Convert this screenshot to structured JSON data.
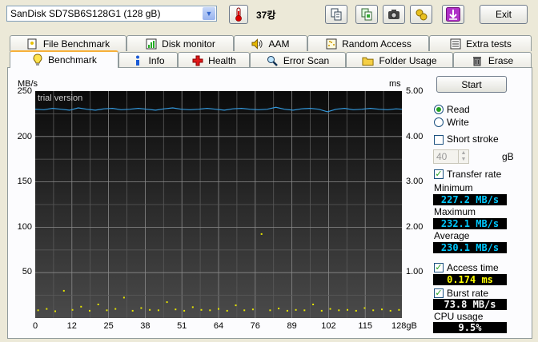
{
  "header": {
    "drive": "SanDisk SD7SB6S128G1 (128 gB)",
    "temperature": "37캉",
    "exit_label": "Exit"
  },
  "tabs_top": [
    {
      "label": "File Benchmark",
      "icon": "file-benchmark-icon"
    },
    {
      "label": "Disk monitor",
      "icon": "disk-monitor-icon"
    },
    {
      "label": "AAM",
      "icon": "speaker-icon"
    },
    {
      "label": "Random Access",
      "icon": "random-access-icon"
    },
    {
      "label": "Extra tests",
      "icon": "extra-tests-icon"
    }
  ],
  "tabs_bottom": [
    {
      "label": "Benchmark",
      "icon": "benchmark-icon",
      "active": true
    },
    {
      "label": "Info",
      "icon": "info-icon"
    },
    {
      "label": "Health",
      "icon": "health-icon"
    },
    {
      "label": "Error Scan",
      "icon": "magnifier-icon"
    },
    {
      "label": "Folder Usage",
      "icon": "folder-icon"
    },
    {
      "label": "Erase",
      "icon": "trash-icon"
    }
  ],
  "controls": {
    "start_label": "Start",
    "read_label": "Read",
    "write_label": "Write",
    "mode_selected": "Read",
    "short_stroke_label": "Short stroke",
    "short_stroke_checked": false,
    "short_stroke_value": "40",
    "short_stroke_unit": "gB",
    "transfer_rate_label": "Transfer rate",
    "transfer_rate_checked": true,
    "minimum_label": "Minimum",
    "minimum_value": "227.2 MB/s",
    "maximum_label": "Maximum",
    "maximum_value": "232.1 MB/s",
    "average_label": "Average",
    "average_value": "230.1 MB/s",
    "access_time_label": "Access time",
    "access_time_checked": true,
    "access_time_value": "0.174 ms",
    "burst_rate_label": "Burst rate",
    "burst_rate_checked": true,
    "burst_rate_value": "73.8 MB/s",
    "cpu_usage_label": "CPU usage",
    "cpu_usage_value": "9.5%"
  },
  "colors": {
    "transfer_line": "#3399dd",
    "access_points": "#e6e600",
    "value_cyan": "#00c8ff",
    "value_yellow": "#ffff00",
    "value_white": "#ffffff"
  },
  "chart_data": {
    "type": "line",
    "watermark": "trial version",
    "y_left_unit": "MB/s",
    "y_right_unit": "ms",
    "y_left_ticks": [
      "250",
      "200",
      "150",
      "100",
      "50"
    ],
    "y_right_ticks": [
      "5.00",
      "4.00",
      "3.00",
      "2.00",
      "1.00"
    ],
    "x_ticks": [
      "0",
      "12",
      "25",
      "38",
      "51",
      "64",
      "76",
      "89",
      "102",
      "115",
      "128gB"
    ],
    "xlim": [
      0,
      128
    ],
    "ylim_left": [
      0,
      250
    ],
    "ylim_right": [
      0,
      5
    ],
    "grid": true,
    "series": [
      {
        "name": "Transfer rate",
        "axis": "left",
        "x": [
          0,
          3,
          6,
          9,
          12,
          15,
          18,
          21,
          24,
          27,
          30,
          33,
          36,
          39,
          42,
          45,
          48,
          51,
          54,
          57,
          60,
          63,
          66,
          69,
          72,
          75,
          78,
          81,
          84,
          87,
          90,
          93,
          96,
          99,
          102,
          105,
          108,
          111,
          114,
          117,
          120,
          123,
          126,
          128
        ],
        "values": [
          230,
          229.5,
          231,
          230,
          229,
          231.5,
          230,
          229,
          230.5,
          231,
          229.5,
          230,
          231,
          230,
          229,
          230.5,
          231.5,
          230,
          229.5,
          230,
          231,
          230,
          229,
          230.5,
          231,
          230,
          229.5,
          230,
          232.1,
          230,
          229,
          230.5,
          231,
          230,
          227.2,
          230,
          231,
          229.5,
          230,
          231,
          230,
          229.5,
          230.5,
          230
        ]
      },
      {
        "name": "Access time",
        "axis": "right",
        "unit": "ms",
        "x": [
          1,
          4,
          7,
          10,
          13,
          16,
          19,
          22,
          25,
          28,
          31,
          34,
          37,
          40,
          43,
          46,
          49,
          52,
          55,
          58,
          61,
          64,
          67,
          70,
          73,
          76,
          79,
          82,
          85,
          88,
          91,
          94,
          97,
          100,
          103,
          106,
          109,
          112,
          115,
          118,
          121,
          124,
          127
        ],
        "values": [
          0.17,
          0.2,
          0.15,
          0.6,
          0.18,
          0.25,
          0.16,
          0.3,
          0.17,
          0.2,
          0.45,
          0.16,
          0.22,
          0.18,
          0.17,
          0.35,
          0.19,
          0.16,
          0.24,
          0.18,
          0.17,
          0.2,
          0.16,
          0.28,
          0.17,
          0.19,
          1.85,
          0.17,
          0.21,
          0.16,
          0.18,
          0.17,
          0.3,
          0.16,
          0.2,
          0.17,
          0.18,
          0.16,
          0.22,
          0.17,
          0.19,
          0.16,
          0.18
        ]
      }
    ]
  }
}
